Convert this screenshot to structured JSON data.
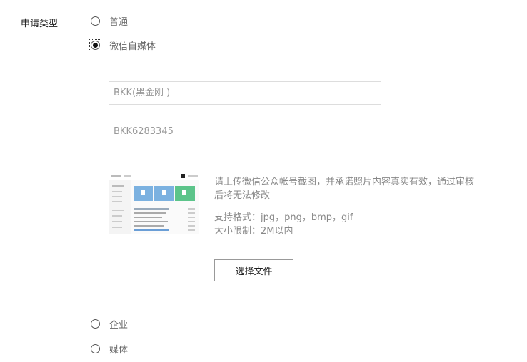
{
  "form": {
    "label": "申请类型",
    "options": [
      {
        "label": "普通",
        "checked": false
      },
      {
        "label": "微信自媒体",
        "checked": true
      },
      {
        "label": "企业",
        "checked": false
      },
      {
        "label": "媒体",
        "checked": false
      }
    ],
    "name_field": {
      "placeholder": "BKK(黑金刚 )"
    },
    "account_field": {
      "placeholder": "BKK6283345"
    },
    "upload": {
      "instruction": "请上传微信公众帐号截图，并承诺照片内容真实有效，通过审核后将无法修改",
      "formats": "支持格式：jpg，png，bmp，gif",
      "size_limit": "大小限制：2M以内",
      "button_label": "选择文件"
    }
  }
}
